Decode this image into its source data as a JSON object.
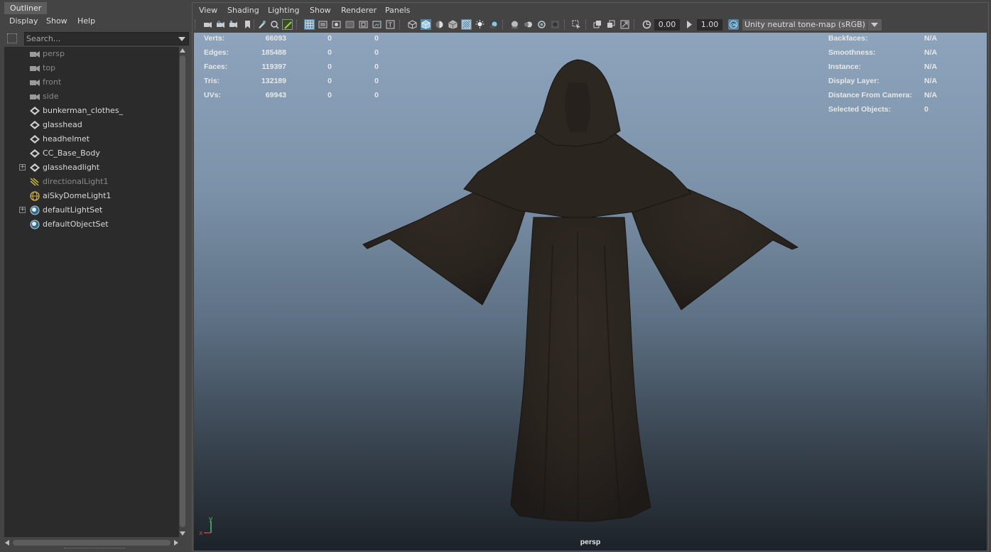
{
  "outliner": {
    "tab_label": "Outliner",
    "menu": [
      "Display",
      "Show",
      "Help"
    ],
    "search_placeholder": "Search...",
    "items": [
      {
        "label": "persp",
        "icon": "camera-icon",
        "dim": true,
        "expandable": false
      },
      {
        "label": "top",
        "icon": "camera-icon",
        "dim": true,
        "expandable": false
      },
      {
        "label": "front",
        "icon": "camera-icon",
        "dim": true,
        "expandable": false
      },
      {
        "label": "side",
        "icon": "camera-icon",
        "dim": true,
        "expandable": false
      },
      {
        "label": "bunkerman_clothes_",
        "icon": "mesh-icon",
        "dim": false,
        "expandable": false
      },
      {
        "label": "glasshead",
        "icon": "mesh-icon",
        "dim": false,
        "expandable": false
      },
      {
        "label": "headhelmet",
        "icon": "mesh-icon",
        "dim": false,
        "expandable": false
      },
      {
        "label": "CC_Base_Body",
        "icon": "mesh-icon",
        "dim": false,
        "expandable": false
      },
      {
        "label": "glassheadlight",
        "icon": "mesh-icon",
        "dim": false,
        "expandable": true
      },
      {
        "label": "directionalLight1",
        "icon": "directional-light-icon",
        "dim": true,
        "expandable": false
      },
      {
        "label": "aiSkyDomeLight1",
        "icon": "sky-dome-light-icon",
        "dim": false,
        "expandable": false
      },
      {
        "label": "defaultLightSet",
        "icon": "set-icon",
        "dim": false,
        "expandable": true
      },
      {
        "label": "defaultObjectSet",
        "icon": "set-icon",
        "dim": false,
        "expandable": false
      }
    ]
  },
  "viewport": {
    "menu": [
      "View",
      "Shading",
      "Lighting",
      "Show",
      "Renderer",
      "Panels"
    ],
    "toolbar": {
      "exposure": "0.00",
      "gamma": "1.00",
      "color_space": "Unity neutral tone-map (sRGB)"
    },
    "hud_left": [
      {
        "label": "Verts:",
        "v1": "66093",
        "v2": "0",
        "v3": "0"
      },
      {
        "label": "Edges:",
        "v1": "185488",
        "v2": "0",
        "v3": "0"
      },
      {
        "label": "Faces:",
        "v1": "119397",
        "v2": "0",
        "v3": "0"
      },
      {
        "label": "Tris:",
        "v1": "132189",
        "v2": "0",
        "v3": "0"
      },
      {
        "label": "UVs:",
        "v1": "69943",
        "v2": "0",
        "v3": "0"
      }
    ],
    "hud_right": [
      {
        "label": "Backfaces:",
        "value": "N/A"
      },
      {
        "label": "Smoothness:",
        "value": "N/A"
      },
      {
        "label": "Instance:",
        "value": "N/A"
      },
      {
        "label": "Display Layer:",
        "value": "N/A"
      },
      {
        "label": "Distance From Camera:",
        "value": "N/A"
      },
      {
        "label": "Selected Objects:",
        "value": "0"
      }
    ],
    "camera_label": "persp",
    "axis": {
      "y": "y",
      "x": "x"
    },
    "colors": {
      "accent": "#5285a6",
      "panel": "#444444",
      "field": "#2b2b2b",
      "robe": "#2a2420"
    }
  }
}
